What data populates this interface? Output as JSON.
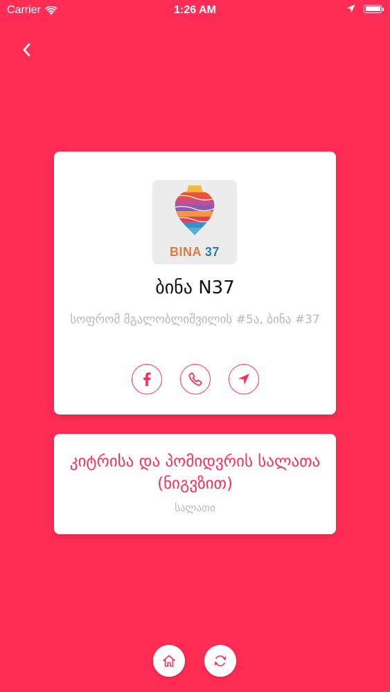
{
  "status_bar": {
    "carrier": "Carrier",
    "time": "1:26 AM"
  },
  "restaurant": {
    "logo_text_primary": "BINA",
    "logo_text_number": "37",
    "name": "ბინა N37",
    "address": "სოფრომ მგალობლიშვილის #5ა, ბინა #37"
  },
  "dish": {
    "name": "კიტრისა და პომიდვრის სალათა (ნიგვზით)",
    "category": "სალათი"
  },
  "icons": {
    "back": "chevron-left-icon",
    "facebook": "facebook-icon",
    "phone": "phone-icon",
    "navigate": "location-arrow-icon",
    "home": "home-icon",
    "refresh": "refresh-icon"
  },
  "colors": {
    "background": "#FF2D55",
    "accent": "#FF2D55",
    "card": "#FFFFFF",
    "muted_text": "#B8B8B8"
  }
}
